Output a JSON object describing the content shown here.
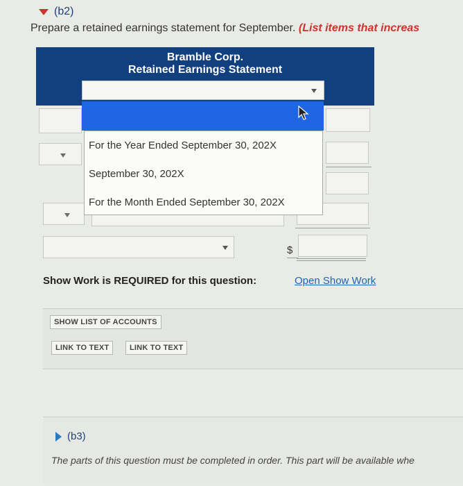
{
  "section_b2": {
    "label": "(b2)"
  },
  "prompt": {
    "text": "Prepare a retained earnings statement for September. ",
    "emphasis": "(List items that increas"
  },
  "statement": {
    "company": "Bramble Corp.",
    "title": "Retained Earnings Statement"
  },
  "date_dropdown": {
    "selected": "",
    "options": [
      "For the Year Ended September 30, 202X",
      "September 30, 202X",
      "For the Month Ended September 30, 202X"
    ]
  },
  "dollar_sign": "$",
  "show_work": {
    "label": "Show Work is REQUIRED for this question:",
    "link": "Open Show Work"
  },
  "buttons": {
    "show_list": "SHOW LIST OF ACCOUNTS",
    "link_to_text_1": "LINK TO TEXT",
    "link_to_text_2": "LINK TO TEXT"
  },
  "section_b3": {
    "label": "(b3)",
    "text": "The parts of this question must be completed in order. This part will be available whe"
  },
  "colors": {
    "header_band": "#123f7d",
    "highlight": "#1f66e5",
    "link": "#2461b3",
    "emphasis_red": "#d2322d"
  }
}
